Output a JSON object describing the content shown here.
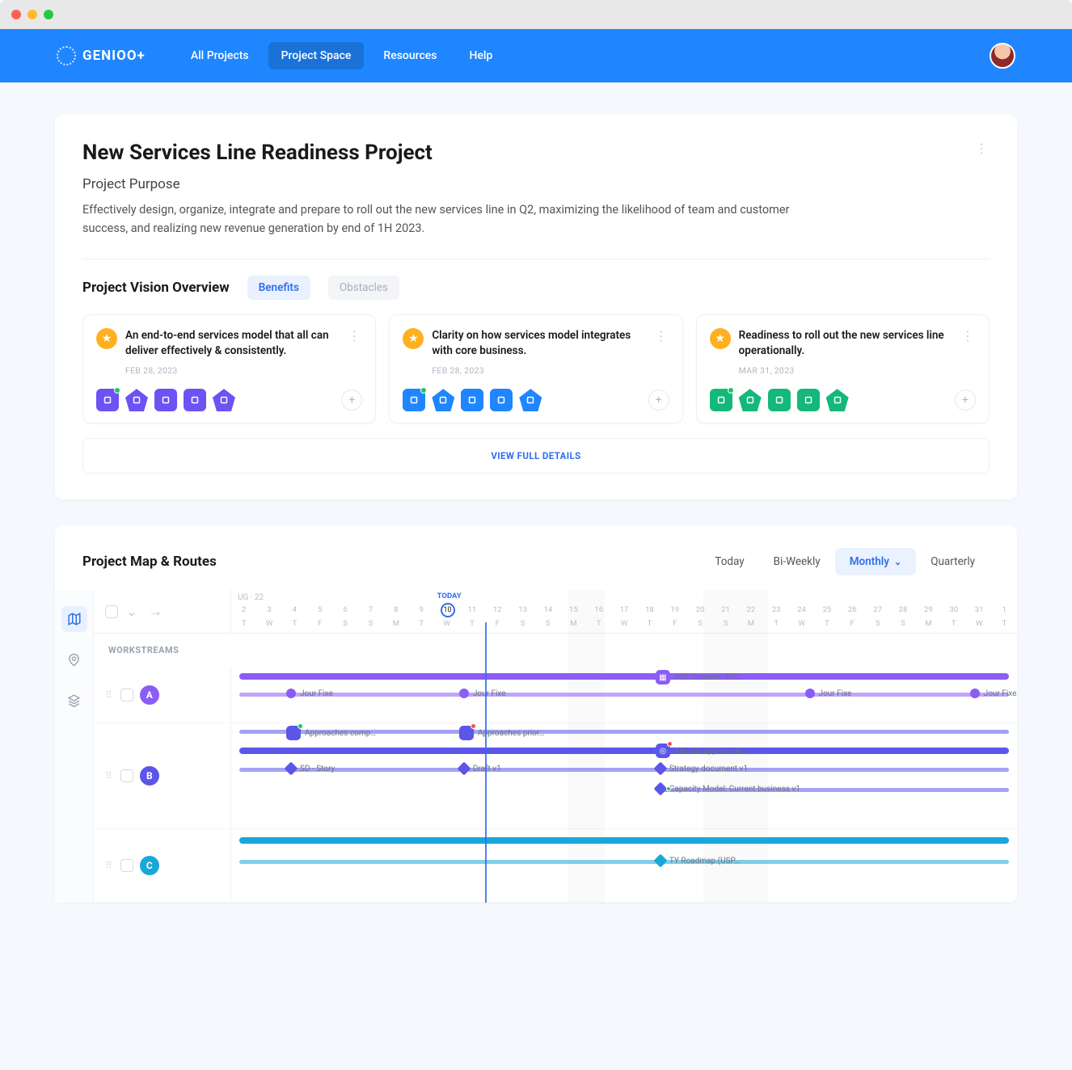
{
  "brand": "GENIOO+",
  "nav": {
    "all_projects": "All Projects",
    "project_space": "Project Space",
    "resources": "Resources",
    "help": "Help"
  },
  "project": {
    "title": "New Services Line Readiness Project",
    "purpose_label": "Project Purpose",
    "purpose_text": "Effectively design, organize, integrate and prepare to roll out the new services line in Q2, maximizing the likelihood of team and customer success, and realizing new revenue generation by end of 1H 2023."
  },
  "vision": {
    "title": "Project Vision Overview",
    "tab_benefits": "Benefits",
    "tab_obstacles": "Obstacles",
    "benefits": [
      {
        "text": "An end-to-end services model that all can deliver effectively & consistently.",
        "date": "FEB 28, 2023",
        "color": "#ffb020",
        "chips": "#6d52f4"
      },
      {
        "text": "Clarity on how services model integrates with core business.",
        "date": "FEB 28, 2023",
        "color": "#ffb020",
        "chips": "#1f86ff"
      },
      {
        "text": "Readiness to roll out the new services line operationally.",
        "date": "MAR 31, 2023",
        "color": "#ffb020",
        "chips": "#14b87a"
      }
    ],
    "full_details": "VIEW FULL DETAILS"
  },
  "routes": {
    "title": "Project Map & Routes",
    "range": {
      "today": "Today",
      "biweekly": "Bi-Weekly",
      "monthly": "Monthly",
      "quarterly": "Quarterly"
    },
    "workstreams_label": "WORKSTREAMS",
    "month_label": "UG · 22",
    "today_label": "TODAY",
    "today_day": "10",
    "days": [
      {
        "n": "2",
        "d": "T"
      },
      {
        "n": "3",
        "d": "W"
      },
      {
        "n": "4",
        "d": "T"
      },
      {
        "n": "5",
        "d": "F"
      },
      {
        "n": "6",
        "d": "S"
      },
      {
        "n": "7",
        "d": "S"
      },
      {
        "n": "8",
        "d": "M"
      },
      {
        "n": "9",
        "d": "T"
      },
      {
        "n": "10",
        "d": "W"
      },
      {
        "n": "11",
        "d": "T"
      },
      {
        "n": "12",
        "d": "F"
      },
      {
        "n": "13",
        "d": "S"
      },
      {
        "n": "14",
        "d": "S"
      },
      {
        "n": "15",
        "d": "M"
      },
      {
        "n": "16",
        "d": "T"
      },
      {
        "n": "17",
        "d": "W"
      },
      {
        "n": "18",
        "d": "T"
      },
      {
        "n": "19",
        "d": "F"
      },
      {
        "n": "20",
        "d": "S"
      },
      {
        "n": "21",
        "d": "S"
      },
      {
        "n": "22",
        "d": "M"
      },
      {
        "n": "23",
        "d": "T"
      },
      {
        "n": "24",
        "d": "W"
      },
      {
        "n": "25",
        "d": "T"
      },
      {
        "n": "26",
        "d": "F"
      },
      {
        "n": "27",
        "d": "S"
      },
      {
        "n": "28",
        "d": "S"
      },
      {
        "n": "29",
        "d": "M"
      },
      {
        "n": "30",
        "d": "T"
      },
      {
        "n": "31",
        "d": "W"
      },
      {
        "n": "1",
        "d": "T"
      }
    ],
    "streams": {
      "a": {
        "label": "A",
        "color": "#8b5cf6",
        "m1": "30% Check-in STC",
        "m2": "Jour Fixe",
        "m3": "Jour Fixe",
        "m4": "Jour Fixe",
        "m5": "Jour Fixe"
      },
      "b": {
        "label": "B",
        "color": "#5b56e8",
        "m1": "Approaches comp…",
        "m2": "Approaches prior…",
        "m3": "Various approache…",
        "m4": "SD - Story",
        "m5": "Draft v1",
        "m6": "Strategy document v1",
        "m7": "Capacity Model: Current business v1"
      },
      "c": {
        "label": "C",
        "color": "#19a7d8",
        "m1": "TY Roadmap (USP…"
      }
    }
  }
}
